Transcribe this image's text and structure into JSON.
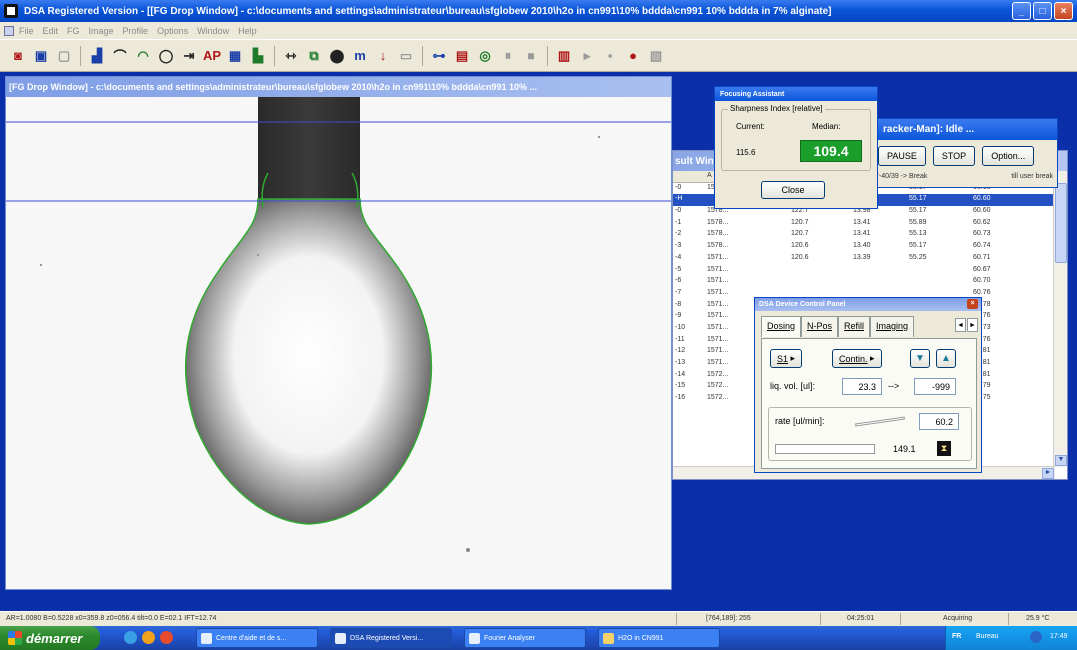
{
  "window": {
    "title": "DSA Registered Version - [[FG Drop Window] - c:\\documents and settings\\administrateur\\bureau\\sfglobew 2010\\h2o in cn991\\10% bddda\\cn991 10% bddda in 7% alginate]",
    "buttons": [
      "_",
      "□",
      "×"
    ]
  },
  "menu": [
    "File",
    "Edit",
    "FG",
    "Image",
    "Profile",
    "Options",
    "Window",
    "Help"
  ],
  "toolbar": {
    "icons": [
      "camera-icon",
      "record-icon",
      "frame-icon",
      "image-icon",
      "curve-icon",
      "sessile-icon",
      "pendant-icon",
      "adjust-icon",
      "ap-icon",
      "table-icon",
      "graph-icon",
      "tilt-icon",
      "image-select-icon",
      "dosing-icon",
      "m-icon",
      "needle-icon",
      "sheet-icon",
      "focus-icon",
      "calc-icon",
      "video-icon",
      "pause-icon",
      "stop-icon",
      "export-icon",
      "play-icon",
      "step-icon",
      "rec-icon",
      "report-icon"
    ]
  },
  "drop_window": {
    "title": "[FG Drop Window] - c:\\documents and settings\\administrateur\\bureau\\sfglobew 2010\\h2o in cn991\\10% bddda\\cn991 10% ..."
  },
  "result_window": {
    "title_partial": "sult Win",
    "columns": [
      "",
      "A",
      "",
      "",
      ""
    ],
    "rows": [
      {
        "id": "-0",
        "t": "15",
        "a": "",
        "b": "",
        "c": "55.17",
        "d": "60.60",
        "selected": false
      },
      {
        "id": "-H",
        "t": "",
        "a": "",
        "b": "13.98 ...",
        "c": "55.17",
        "d": "60.60",
        "selected": true
      },
      {
        "id": "-0",
        "t": "1578...",
        "a": "122.7",
        "b": "13.98",
        "c": "55.17",
        "d": "60.60",
        "selected": false
      },
      {
        "id": "-1",
        "t": "1578...",
        "a": "120.7",
        "b": "13.41",
        "c": "55.89",
        "d": "60.62",
        "selected": false
      },
      {
        "id": "-2",
        "t": "1578...",
        "a": "120.7",
        "b": "13.41",
        "c": "55.13",
        "d": "60.73",
        "selected": false
      },
      {
        "id": "-3",
        "t": "1578...",
        "a": "120.6",
        "b": "13.40",
        "c": "55.17",
        "d": "60.74",
        "selected": false
      },
      {
        "id": "-4",
        "t": "1571...",
        "a": "120.6",
        "b": "13.39",
        "c": "55.25",
        "d": "60.71",
        "selected": false
      },
      {
        "id": "-5",
        "t": "1571...",
        "a": "",
        "b": "",
        "c": "",
        "d": "60.67",
        "selected": false
      },
      {
        "id": "-6",
        "t": "1571...",
        "a": "",
        "b": "",
        "c": "",
        "d": "60.70",
        "selected": false
      },
      {
        "id": "-7",
        "t": "1571...",
        "a": "",
        "b": "",
        "c": "",
        "d": "60.76",
        "selected": false
      },
      {
        "id": "-8",
        "t": "1571...",
        "a": "",
        "b": "",
        "c": "",
        "d": "60.78",
        "selected": false
      },
      {
        "id": "-9",
        "t": "1571...",
        "a": "",
        "b": "",
        "c": "",
        "d": "60.76",
        "selected": false
      },
      {
        "id": "-10",
        "t": "1571...",
        "a": "",
        "b": "",
        "c": "",
        "d": "60.73",
        "selected": false
      },
      {
        "id": "-11",
        "t": "1571...",
        "a": "",
        "b": "",
        "c": "",
        "d": "60.76",
        "selected": false
      },
      {
        "id": "-12",
        "t": "1571...",
        "a": "",
        "b": "",
        "c": "",
        "d": "60.81",
        "selected": false
      },
      {
        "id": "-13",
        "t": "1571...",
        "a": "",
        "b": "",
        "c": "",
        "d": "60.81",
        "selected": false
      },
      {
        "id": "-14",
        "t": "1572...",
        "a": "",
        "b": "",
        "c": "",
        "d": "60.81",
        "selected": false
      },
      {
        "id": "-15",
        "t": "1572...",
        "a": "",
        "b": "",
        "c": "",
        "d": "60.79",
        "selected": false
      },
      {
        "id": "-16",
        "t": "1572...",
        "a": "",
        "b": "",
        "c": "",
        "d": "60.75",
        "selected": false
      }
    ]
  },
  "tracker": {
    "title": "racker-Man]: Idle ...",
    "pause": "PAUSE",
    "stop": "STOP",
    "option": "Option...",
    "status_left": "7-40/39 -> Break",
    "status_right": "till user break"
  },
  "focus": {
    "title": "Focusing Assistant",
    "group_label": "Sharpness Index [relative]",
    "current_label": "Current:",
    "median_label": "Median:",
    "current_value": "115.6",
    "median_value": "109.4",
    "close": "Close"
  },
  "device": {
    "title": "DSA Device Control Panel",
    "tabs": [
      "Dosing",
      "N-Pos",
      "Refill",
      "Imaging"
    ],
    "active_tab": 0,
    "syringe": "S1",
    "mode": "Contin.",
    "liq_vol_label": "liq. vol. [ul]:",
    "liq_vol_value": "23.3",
    "liq_vol_arrow": "-->",
    "liq_vol_target": "-999",
    "rate_label": "rate [ul/min]:",
    "rate_value": "60.2",
    "progress_value": "149.1"
  },
  "statusbar": {
    "left": "AR=1.0080 B=0.5228 x0=359.8 z0=056.4 tilt=0.0 E=02.1 IFT=12.74",
    "coords": "[764,189]: 255",
    "time": "04:25:01",
    "state": "Acquiring",
    "temp": "25.9 °C"
  },
  "taskbar": {
    "start": "démarrer",
    "tasks": [
      "Centre d'aide et de s...",
      "DSA Registered Versi...",
      "Fourier Analyser",
      "H2O in CN991"
    ],
    "lang": "FR",
    "tray_label": "Bureau",
    "clock": "17:49"
  }
}
